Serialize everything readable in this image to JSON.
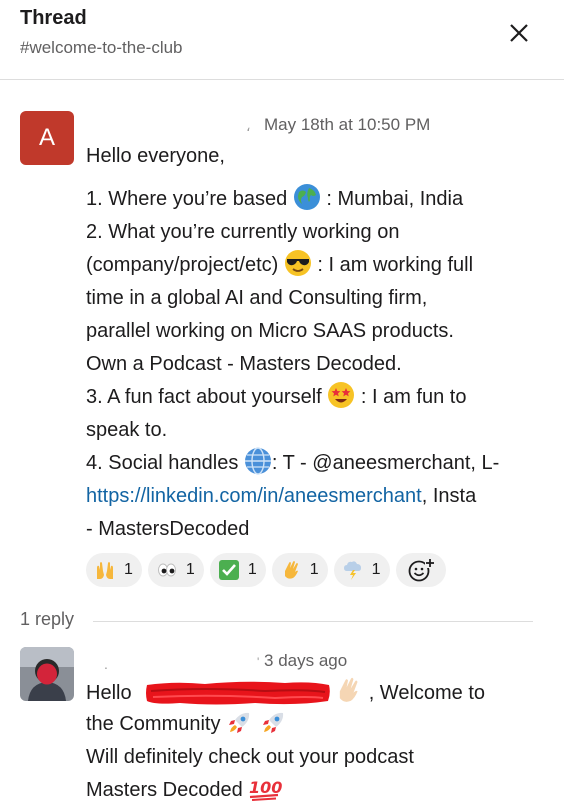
{
  "header": {
    "title": "Thread",
    "channel": "#welcome-to-the-club"
  },
  "parent_message": {
    "avatar_letter": "A",
    "author_faded": "،",
    "timestamp": "May 18th at 10:50 PM",
    "lines": {
      "l1": "Hello everyone,",
      "l2a": "1. Where you’re based ",
      "l2b": " : Mumbai, India",
      "l3": "2. What you’re currently working on",
      "l4a": "(company/project/etc) ",
      "l4b": " : I am working full",
      "l5": "time in a global AI and Consulting firm,",
      "l6": "parallel working on Micro SAAS products.",
      "l7": "Own a Podcast - Masters Decoded.",
      "l8a": "3. A fun fact about yourself ",
      "l8b": " : I am fun to",
      "l9": "speak to.",
      "l10a": "4. Social handles ",
      "l10b": ": T - @aneesmerchant, L-",
      "l11_link": "https://linkedin.com/in/aneesmerchant",
      "l11b": ", Insta",
      "l12": "- MastersDecoded"
    },
    "reactions": [
      {
        "icon": "raised-hands-icon",
        "count": "1"
      },
      {
        "icon": "eyes-icon",
        "count": "1"
      },
      {
        "icon": "check-mark-icon",
        "count": "1"
      },
      {
        "icon": "waving-hand-icon",
        "count": "1"
      },
      {
        "icon": "cloud-lightning-icon",
        "count": "1"
      }
    ]
  },
  "replies": {
    "label": "1 reply"
  },
  "reply_message": {
    "timestamp": "3 days ago",
    "line1a": "Hello ",
    "line1b": " , Welcome to",
    "line2": "the Community ",
    "line3": "Will definitely check out your podcast",
    "line4": "Masters Decoded "
  },
  "colors": {
    "avatar_bg": "#c0392b",
    "link": "#1264a3",
    "redaction": "#e8141b"
  }
}
